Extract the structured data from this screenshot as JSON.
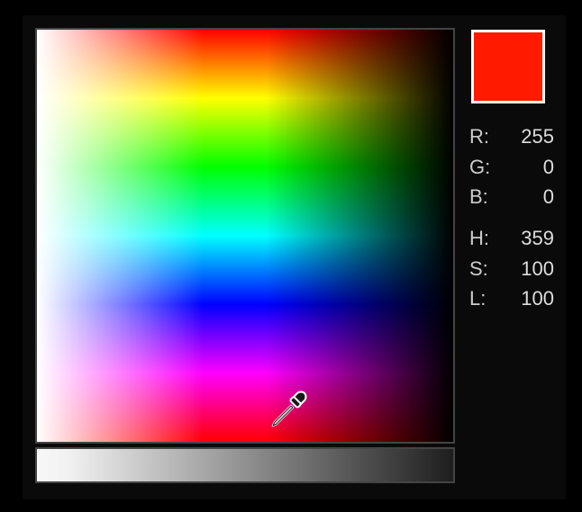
{
  "current_color_hex": "#ff1a00",
  "rgb": {
    "r_label": "R:",
    "g_label": "G:",
    "b_label": "B:",
    "r": "255",
    "g": "0",
    "b": "0"
  },
  "hsl": {
    "h_label": "H:",
    "s_label": "S:",
    "l_label": "L:",
    "h": "359",
    "s": "100",
    "l": "100"
  }
}
